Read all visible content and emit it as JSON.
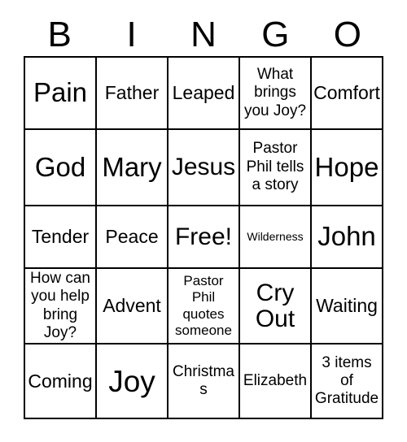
{
  "card": {
    "title": "Bingo Card",
    "header_letters": [
      "B",
      "I",
      "N",
      "G",
      "O"
    ],
    "colors": {
      "background": "#ffffff",
      "text": "#000000",
      "grid_line": "#000000"
    },
    "rows": [
      {
        "cells": [
          {
            "text": "Pain",
            "size": "xl"
          },
          {
            "text": "Father",
            "size": "md"
          },
          {
            "text": "Leaped",
            "size": "md"
          },
          {
            "text": "What brings you Joy?",
            "size": "sm"
          },
          {
            "text": "Comfort",
            "size": "md"
          }
        ]
      },
      {
        "cells": [
          {
            "text": "God",
            "size": "xl"
          },
          {
            "text": "Mary",
            "size": "xl"
          },
          {
            "text": "Jesus",
            "size": "lg"
          },
          {
            "text": "Pastor Phil tells a story",
            "size": "sm"
          },
          {
            "text": "Hope",
            "size": "xl"
          }
        ]
      },
      {
        "cells": [
          {
            "text": "Tender",
            "size": "md"
          },
          {
            "text": "Peace",
            "size": "md"
          },
          {
            "text": "Free!",
            "size": "lg"
          },
          {
            "text": "Wilderness",
            "size": "tiny"
          },
          {
            "text": "John",
            "size": "xl"
          }
        ]
      },
      {
        "cells": [
          {
            "text": "How can you help bring Joy?",
            "size": "sm"
          },
          {
            "text": "Advent",
            "size": "md"
          },
          {
            "text": "Pastor Phil quotes someone",
            "size": "xs"
          },
          {
            "text": "Cry Out",
            "size": "lg"
          },
          {
            "text": "Waiting",
            "size": "md"
          }
        ]
      },
      {
        "cells": [
          {
            "text": "Coming",
            "size": "md"
          },
          {
            "text": "Joy",
            "size": "xxl"
          },
          {
            "text": "Christmas",
            "size": "sm"
          },
          {
            "text": "Elizabeth",
            "size": "sm"
          },
          {
            "text": "3 items of Gratitude",
            "size": "sm"
          }
        ]
      }
    ]
  }
}
